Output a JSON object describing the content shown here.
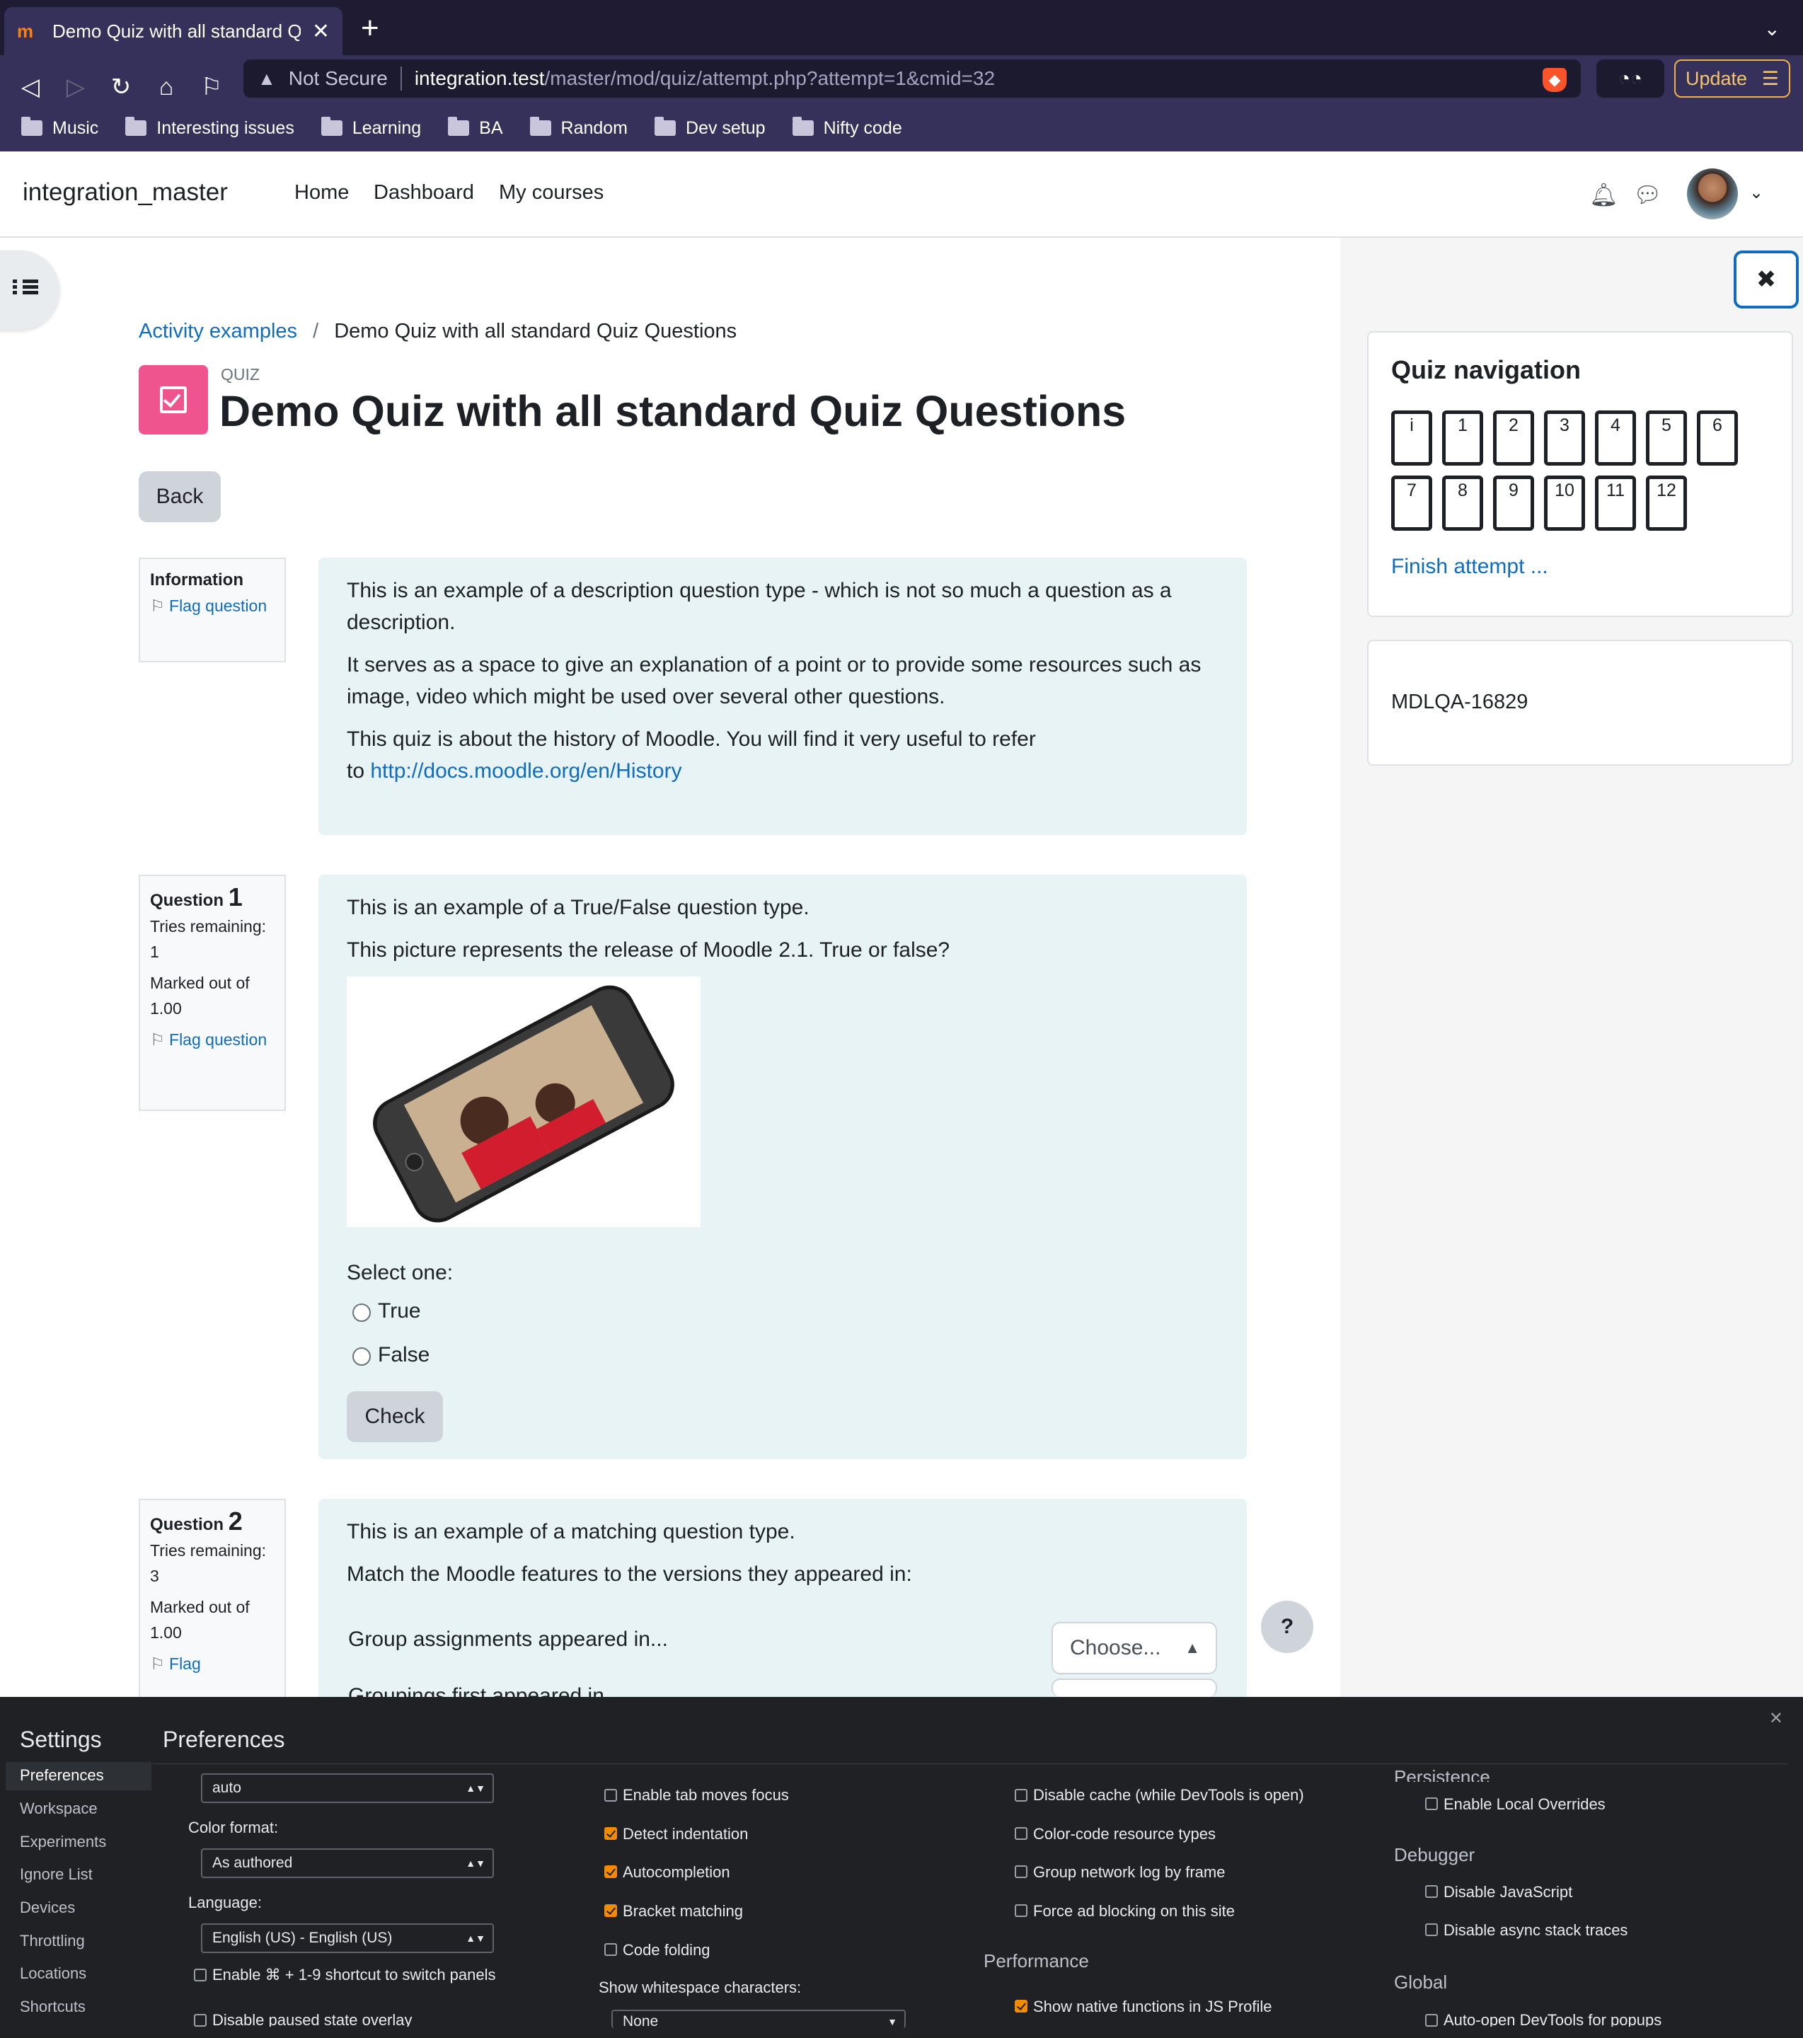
{
  "browser": {
    "tab_title": "Demo Quiz with all standard Qu",
    "tab_favicon": "m",
    "security_label": "Not Secure",
    "url_host": "integration.test",
    "url_path": "/master/mod/quiz/attempt.php?attempt=1&cmid=32",
    "update_label": "Update",
    "bookmarks": [
      "Music",
      "Interesting issues",
      "Learning",
      "BA",
      "Random",
      "Dev setup",
      "Nifty code"
    ]
  },
  "site": {
    "name": "integration_master",
    "nav": [
      "Home",
      "Dashboard",
      "My courses"
    ]
  },
  "breadcrumb": {
    "parent": "Activity examples",
    "separator": "/",
    "current": "Demo Quiz with all standard Quiz Questions"
  },
  "page": {
    "activity_type": "QUIZ",
    "title": "Demo Quiz with all standard Quiz Questions",
    "back_label": "Back"
  },
  "info_block": {
    "heading": "Information",
    "flag_label": "Flag question"
  },
  "info_question": {
    "p1": "This is an example of a description question type - which is not so much a question as a description.",
    "p2": "It serves as a space to give an explanation of a point or to provide some resources such as image, video which might be used over several other questions.",
    "p3_prefix": "This quiz is about the history of Moodle. You will find it very useful to refer",
    "p3_to": "to",
    "link": "http://docs.moodle.org/en/History"
  },
  "q1": {
    "label": "Question",
    "number": "1",
    "tries": "Tries remaining: 1",
    "marked": "Marked out of 1.00",
    "flag": "Flag question",
    "intro": "This is an example of a True/False question type.",
    "text": "This picture represents the release of  Moodle 2.1. True or false?",
    "select_one": "Select one:",
    "options": [
      "True",
      "False"
    ],
    "check_label": "Check"
  },
  "q2": {
    "label": "Question",
    "number": "2",
    "tries": "Tries remaining: 3",
    "marked": "Marked out of 1.00",
    "flag": "Flag",
    "intro": "This is an example of a matching question type.",
    "text": "Match the Moodle features to the versions they appeared in:",
    "item1": "Group assignments appeared in...",
    "item2": "Groupings first appeared in...",
    "choose": "Choose..."
  },
  "quiz_nav": {
    "title": "Quiz navigation",
    "buttons": [
      "i",
      "1",
      "2",
      "3",
      "4",
      "5",
      "6",
      "7",
      "8",
      "9",
      "10",
      "11",
      "12"
    ],
    "finish": "Finish attempt ..."
  },
  "side_block": {
    "text": "MDLQA-16829"
  },
  "help_label": "?",
  "devtools": {
    "settings_title": "Settings",
    "pane_title": "Preferences",
    "sidebar": [
      "Preferences",
      "Workspace",
      "Experiments",
      "Ignore List",
      "Devices",
      "Throttling",
      "Locations",
      "Shortcuts"
    ],
    "col1": {
      "theme_value": "auto",
      "color_format_label": "Color format:",
      "color_format_value": "As authored",
      "language_label": "Language:",
      "language_value": "English (US) - English (US)",
      "shortcut_label": "Enable ⌘ + 1-9 shortcut to switch panels",
      "paused_label": "Disable paused state overlay"
    },
    "col2": {
      "items": [
        {
          "label": "Enable tab moves focus",
          "checked": false
        },
        {
          "label": "Detect indentation",
          "checked": true
        },
        {
          "label": "Autocompletion",
          "checked": true
        },
        {
          "label": "Bracket matching",
          "checked": true
        },
        {
          "label": "Code folding",
          "checked": false
        }
      ],
      "whitespace_label": "Show whitespace characters:",
      "whitespace_value": "None"
    },
    "col3": {
      "items": [
        {
          "label": "Disable cache (while DevTools is open)",
          "checked": false
        },
        {
          "label": "Color-code resource types",
          "checked": false
        },
        {
          "label": "Group network log by frame",
          "checked": false
        },
        {
          "label": "Force ad blocking on this site",
          "checked": false
        }
      ],
      "performance_heading": "Performance",
      "native_label": "Show native functions in JS Profile"
    },
    "col4": {
      "persistence_heading": "Persistence",
      "local_overrides": "Enable Local Overrides",
      "debugger_heading": "Debugger",
      "disable_js": "Disable JavaScript",
      "disable_async": "Disable async stack traces",
      "global_heading": "Global",
      "auto_open": "Auto-open DevTools for popups"
    }
  },
  "colors": {
    "moodle_blue": "#0f6cbf",
    "quiz_icon": "#f0548f",
    "question_bg": "#e7f3f5",
    "browser_dark": "#35315a",
    "devtools_bg": "#202124",
    "checkbox_on": "#f28b00"
  }
}
